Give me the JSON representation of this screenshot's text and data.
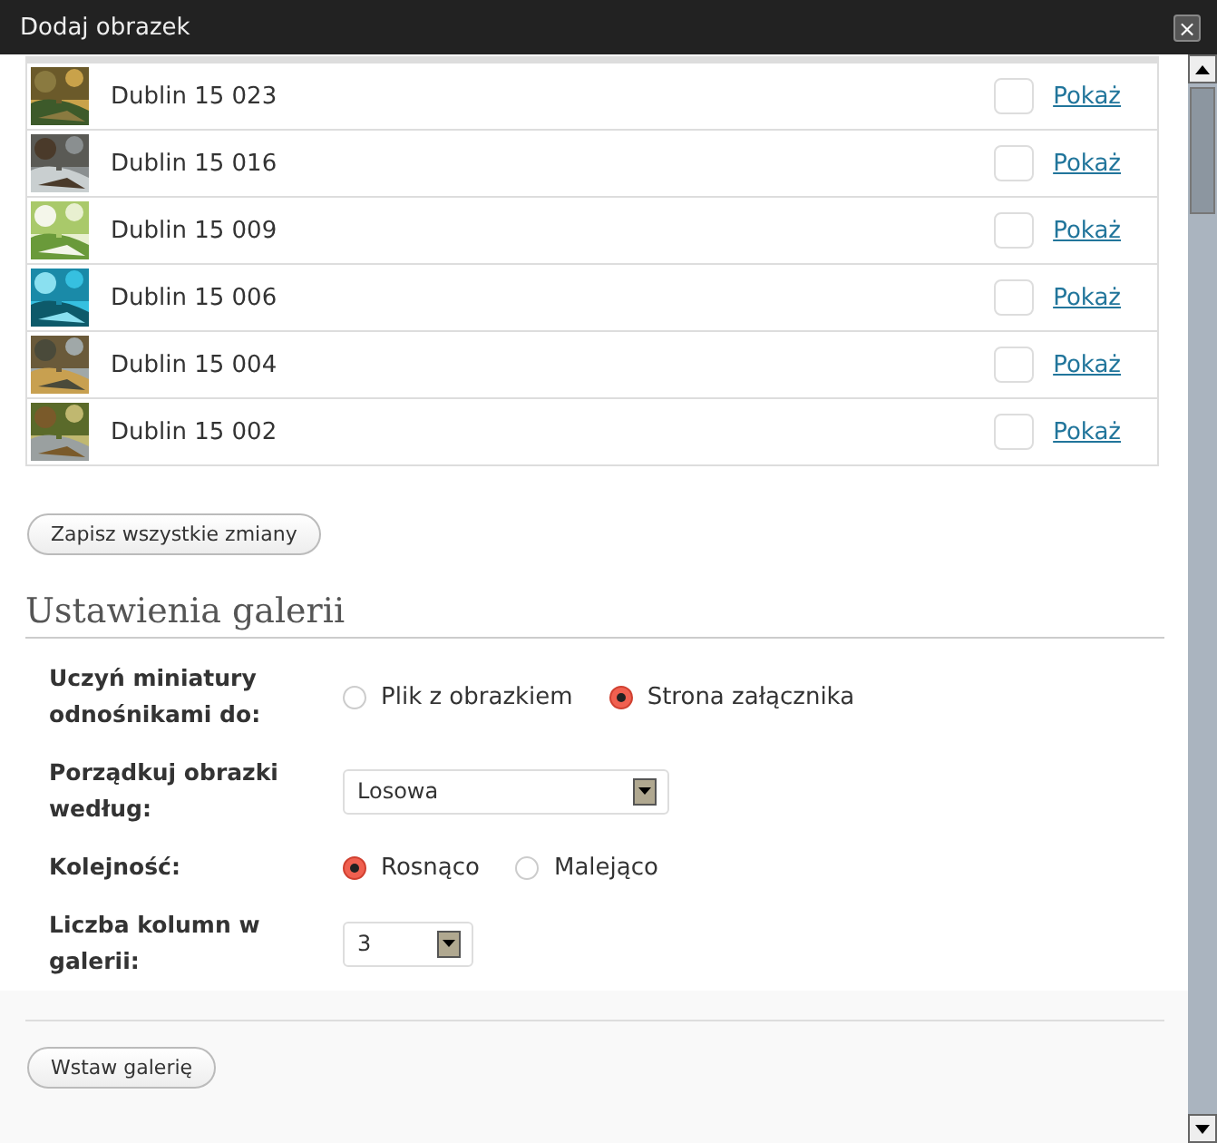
{
  "window": {
    "title": "Dodaj obrazek",
    "close": "×"
  },
  "images": [
    {
      "name": "Dublin 15 023",
      "checked": false,
      "link": "Pokaż"
    },
    {
      "name": "Dublin 15 016",
      "checked": false,
      "link": "Pokaż"
    },
    {
      "name": "Dublin 15 009",
      "checked": false,
      "link": "Pokaż"
    },
    {
      "name": "Dublin 15 006",
      "checked": false,
      "link": "Pokaż"
    },
    {
      "name": "Dublin 15 004",
      "checked": false,
      "link": "Pokaż"
    },
    {
      "name": "Dublin 15 002",
      "checked": false,
      "link": "Pokaż"
    }
  ],
  "save_button": "Zapisz wszystkie zmiany",
  "gallery_settings": {
    "title": "Ustawienia galerii",
    "rows": [
      {
        "kind": "radio",
        "label": "Uczyń miniatury odnośnikami do:",
        "options": [
          {
            "label": "Plik z obrazkiem",
            "selected": false
          },
          {
            "label": "Strona załącznika",
            "selected": true
          }
        ]
      },
      {
        "kind": "select",
        "label": "Porządkuj obrazki według:",
        "value": "Losowa"
      },
      {
        "kind": "radio",
        "label": "Kolejność:",
        "options": [
          {
            "label": "Rosnąco",
            "selected": true
          },
          {
            "label": "Malejąco",
            "selected": false
          }
        ]
      },
      {
        "kind": "select",
        "label": "Liczba kolumn w galerii:",
        "value": "3"
      }
    ]
  },
  "insert_button": "Wstaw galerię"
}
